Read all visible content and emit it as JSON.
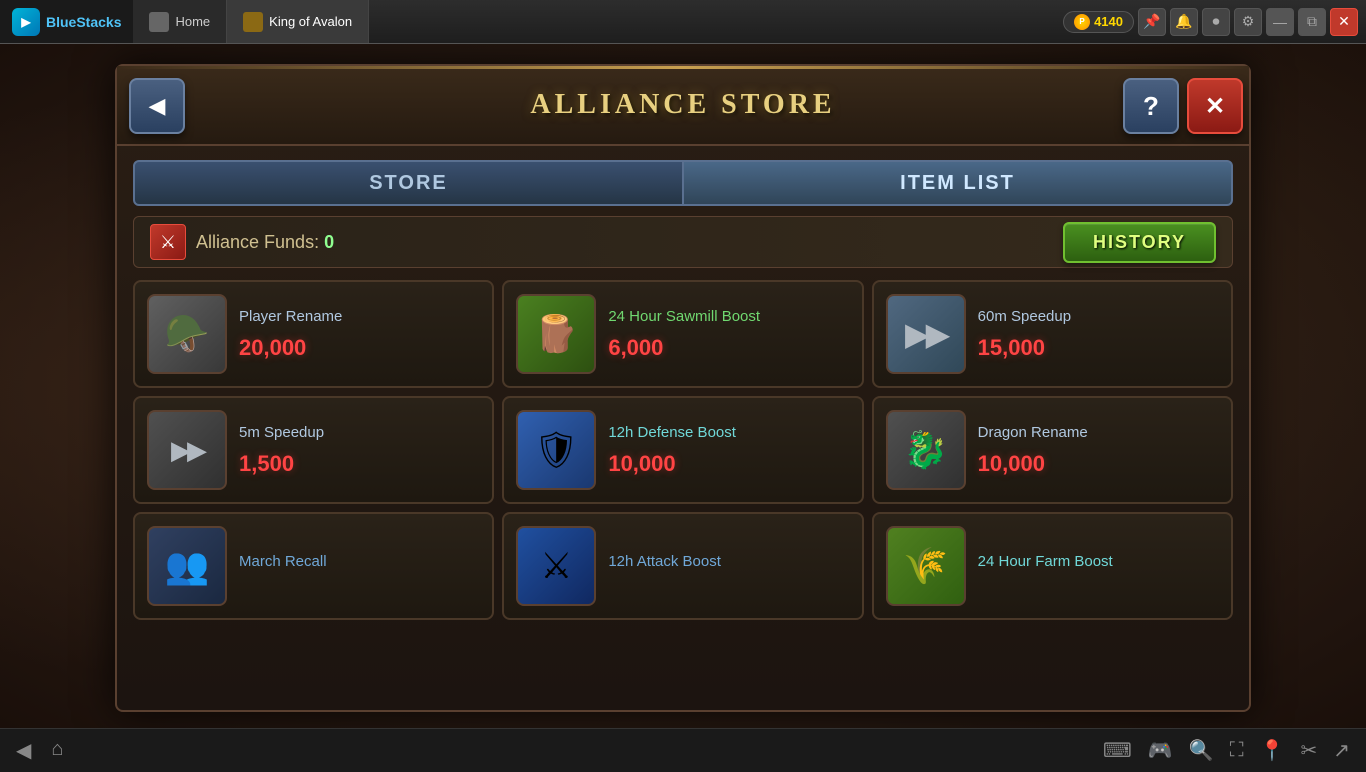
{
  "titlebar": {
    "app_name": "BlueStacks",
    "home_label": "Home",
    "game_tab_label": "King of Avalon",
    "points": "4140",
    "points_prefix": "P"
  },
  "modal": {
    "title": "ALLIANCE STORE",
    "back_label": "◀",
    "help_label": "?",
    "close_label": "✕",
    "tabs": {
      "store": "STORE",
      "item_list": "ITEM LIST"
    },
    "funds": {
      "label": "Alliance Funds: ",
      "amount": "0"
    },
    "history_btn": "HISTORY",
    "items": [
      {
        "name": "Player Rename",
        "price": "20,000",
        "icon": "🪖",
        "icon_type": "helmet"
      },
      {
        "name": "24 Hour Sawmill Boost",
        "price": "6,000",
        "icon": "🪵",
        "icon_type": "wood"
      },
      {
        "name": "60m Speedup",
        "price": "15,000",
        "icon": "▶▶",
        "icon_type": "speedup-large"
      },
      {
        "name": "5m Speedup",
        "price": "1,500",
        "icon": "▶▶",
        "icon_type": "speedup-small"
      },
      {
        "name": "12h Defense Boost",
        "price": "10,000",
        "icon": "🛡",
        "icon_type": "defense"
      },
      {
        "name": "Dragon Rename",
        "price": "10,000",
        "icon": "🐉",
        "icon_type": "dragon"
      },
      {
        "name": "March Recall",
        "price": "",
        "icon": "👥",
        "icon_type": "march"
      },
      {
        "name": "12h Attack Boost",
        "price": "",
        "icon": "⚔",
        "icon_type": "attack"
      },
      {
        "name": "24 Hour Farm Boost",
        "price": "",
        "icon": "🌾",
        "icon_type": "farm"
      }
    ]
  }
}
